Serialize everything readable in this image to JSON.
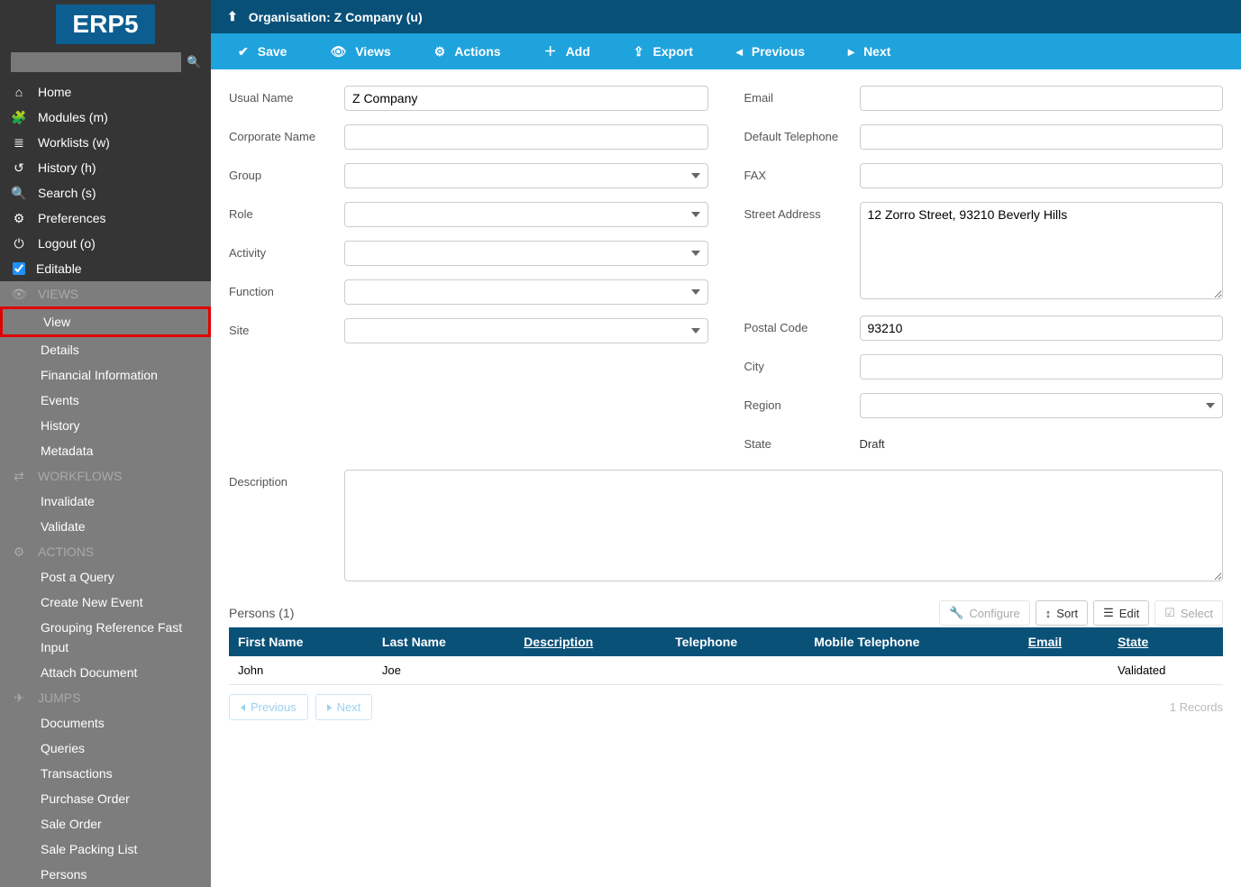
{
  "app": {
    "logo": "ERP5"
  },
  "nav": [
    {
      "icon": "⌂",
      "label": "Home",
      "name": "nav-home"
    },
    {
      "icon": "🧩",
      "label": "Modules (m)",
      "name": "nav-modules"
    },
    {
      "icon": "≣",
      "label": "Worklists (w)",
      "name": "nav-worklists"
    },
    {
      "icon": "↺",
      "label": "History (h)",
      "name": "nav-history"
    },
    {
      "icon": "🔍",
      "label": "Search (s)",
      "name": "nav-search"
    },
    {
      "icon": "⚙",
      "label": "Preferences",
      "name": "nav-preferences"
    },
    {
      "icon": "⏻",
      "label": "Logout (o)",
      "name": "nav-logout"
    }
  ],
  "editable_label": "Editable",
  "sections": {
    "views": {
      "title": "VIEWS",
      "items": [
        "View",
        "Details",
        "Financial Information",
        "Events",
        "History",
        "Metadata"
      ]
    },
    "workflows": {
      "title": "WORKFLOWS",
      "items": [
        "Invalidate",
        "Validate"
      ]
    },
    "actions": {
      "title": "ACTIONS",
      "items": [
        "Post a Query",
        "Create New Event",
        "Grouping Reference Fast Input",
        "Attach Document"
      ]
    },
    "jumps": {
      "title": "JUMPS",
      "items": [
        "Documents",
        "Queries",
        "Transactions",
        "Purchase Order",
        "Sale Order",
        "Sale Packing List",
        "Persons"
      ]
    }
  },
  "header": {
    "breadcrumb": "Organisation: Z Company (u)"
  },
  "toolbar": [
    {
      "icon": "✔",
      "label": "Save",
      "name": "tb-save"
    },
    {
      "icon": "👁",
      "label": "Views",
      "name": "tb-views"
    },
    {
      "icon": "⚙",
      "label": "Actions",
      "name": "tb-actions"
    },
    {
      "icon": "＋",
      "label": "Add",
      "name": "tb-add"
    },
    {
      "icon": "⇪",
      "label": "Export",
      "name": "tb-export"
    },
    {
      "icon": "◂",
      "label": "Previous",
      "name": "tb-previous"
    },
    {
      "icon": "▸",
      "label": "Next",
      "name": "tb-next"
    }
  ],
  "form": {
    "usual_name": {
      "label": "Usual Name",
      "value": "Z Company"
    },
    "corporate_name": {
      "label": "Corporate Name",
      "value": ""
    },
    "group": {
      "label": "Group"
    },
    "role": {
      "label": "Role"
    },
    "activity": {
      "label": "Activity"
    },
    "function": {
      "label": "Function"
    },
    "site": {
      "label": "Site"
    },
    "email": {
      "label": "Email",
      "value": ""
    },
    "default_phone": {
      "label": "Default Telephone",
      "value": ""
    },
    "fax": {
      "label": "FAX",
      "value": ""
    },
    "street": {
      "label": "Street Address",
      "value": "12 Zorro Street, 93210 Beverly Hills"
    },
    "postal": {
      "label": "Postal Code",
      "value": "93210"
    },
    "city": {
      "label": "City",
      "value": ""
    },
    "region": {
      "label": "Region"
    },
    "state": {
      "label": "State",
      "value": "Draft"
    },
    "description": {
      "label": "Description",
      "value": ""
    }
  },
  "persons": {
    "title": "Persons (1)",
    "tools": {
      "configure": "Configure",
      "sort": "Sort",
      "edit": "Edit",
      "select": "Select"
    },
    "columns": [
      "First Name",
      "Last Name",
      "Description",
      "Telephone",
      "Mobile Telephone",
      "Email",
      "State"
    ],
    "rows": [
      {
        "cells": [
          "John",
          "Joe",
          "",
          "",
          "",
          "",
          "Validated"
        ]
      }
    ],
    "paging": {
      "prev": "Previous",
      "next": "Next",
      "count": "1 Records"
    }
  }
}
